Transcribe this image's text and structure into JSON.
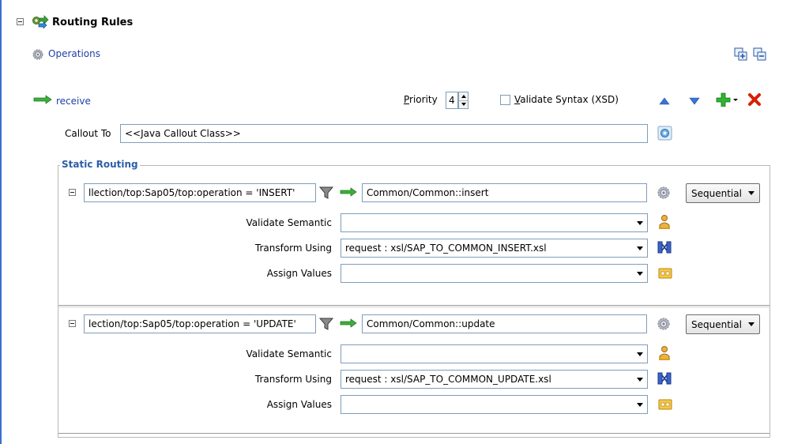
{
  "header": {
    "title": "Routing Rules"
  },
  "operations": {
    "label": "Operations"
  },
  "rule": {
    "operation_name": "receive",
    "priority_label_u": "P",
    "priority_label_rest": "riority",
    "priority_value": "4",
    "validate_syntax_u": "V",
    "validate_syntax_rest": "alidate Syntax (XSD)",
    "callout_label": "Callout To",
    "callout_value": "<<Java Callout Class>>"
  },
  "static_routing": {
    "legend": "Static Routing",
    "routes": [
      {
        "filter": "llection/top:Sap05/top:operation = 'INSERT'",
        "target": "Common/Common::insert",
        "mode": "Sequential",
        "validate_label": "Validate Semantic",
        "validate_value": "",
        "transform_label": "Transform Using",
        "transform_value": "request : xsl/SAP_TO_COMMON_INSERT.xsl",
        "assign_label": "Assign Values",
        "assign_value": ""
      },
      {
        "filter": "lection/top:Sap05/top:operation = 'UPDATE'",
        "target": "Common/Common::update",
        "mode": "Sequential",
        "validate_label": "Validate Semantic",
        "validate_value": "",
        "transform_label": "Transform Using",
        "transform_value": "request : xsl/SAP_TO_COMMON_UPDATE.xsl",
        "assign_label": "Assign Values",
        "assign_value": ""
      }
    ]
  },
  "icons": {
    "routing_rules": "routing-rules-icon",
    "operations": "gear-icon",
    "expand_all": "expand-all-icon",
    "collapse_all": "collapse-all-icon",
    "receive": "green-arrow-icon",
    "move_up": "up-triangle-icon",
    "move_down": "down-triangle-icon",
    "add": "green-plus-icon",
    "delete": "red-x-icon",
    "callout_browse": "browse-icon",
    "filter": "filter-funnel-icon",
    "target_arrow": "green-arrow-icon",
    "target_browse": "gear-icon",
    "validate_browse": "person-icon",
    "transform_browse": "xsl-map-icon",
    "assign_browse": "assign-icon"
  },
  "colors": {
    "accent": "#3b6fd1",
    "legend": "#2d5ea8",
    "link": "#1f3ea8",
    "add": "#1fa31f",
    "delete": "#d81e05"
  }
}
